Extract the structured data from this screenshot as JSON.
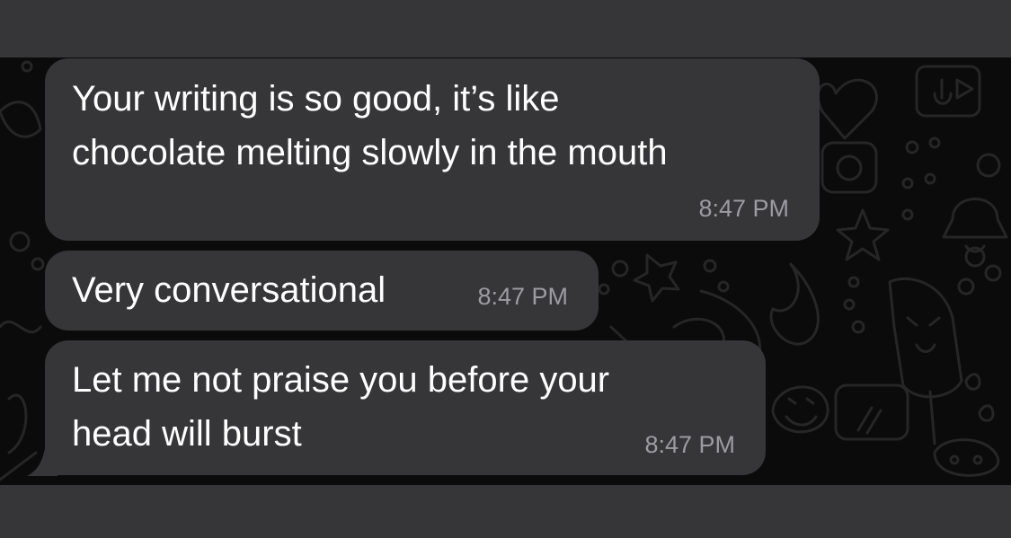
{
  "messages": [
    {
      "lines": [
        "Your writing is so good, it’s like",
        "chocolate melting slowly in the mouth"
      ],
      "time": "8:47 PM"
    },
    {
      "lines": [
        "Very conversational"
      ],
      "time": "8:47 PM"
    },
    {
      "lines": [
        "Let me not praise you before your",
        "head will burst"
      ],
      "time": "8:47 PM"
    }
  ],
  "colors": {
    "bubble": "#363638",
    "chat_background": "#0b0b0b",
    "timestamp": "#9c9ca1",
    "text": "#ffffff"
  },
  "icons": [
    "doodle-wallpaper-icons"
  ]
}
